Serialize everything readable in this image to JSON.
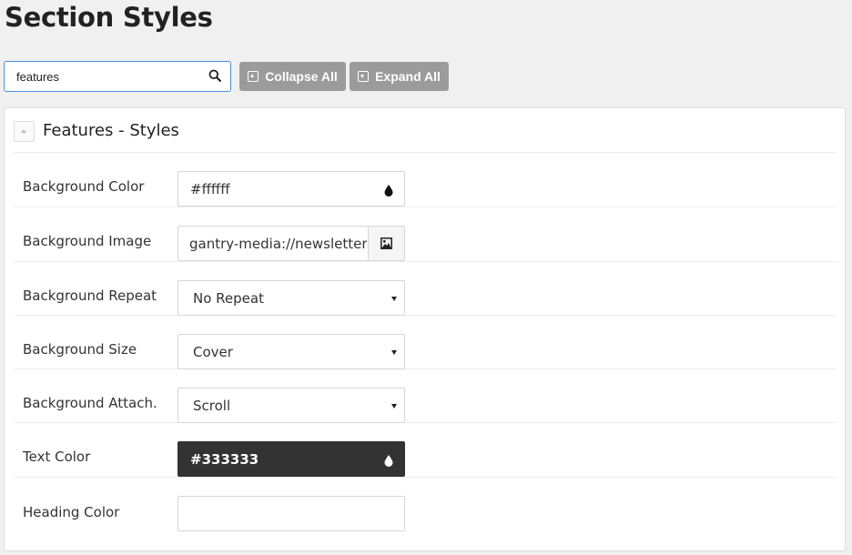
{
  "page": {
    "title": "Section Styles"
  },
  "toolbar": {
    "search_value": "features",
    "collapse_label": "Collapse All",
    "expand_label": "Expand All"
  },
  "panel": {
    "title": "Features - Styles",
    "fields": [
      {
        "label": "Background Color",
        "value": "#ffffff",
        "kind": "color"
      },
      {
        "label": "Background Image",
        "value": "gantry-media://newsletter.",
        "kind": "image"
      },
      {
        "label": "Background Repeat",
        "value": "No Repeat",
        "kind": "select"
      },
      {
        "label": "Background Size",
        "value": "Cover",
        "kind": "select"
      },
      {
        "label": "Background Attach.",
        "value": "Scroll",
        "kind": "select"
      },
      {
        "label": "Text Color",
        "value": "#333333",
        "kind": "color"
      },
      {
        "label": "Heading Color",
        "value": "",
        "kind": "color"
      }
    ]
  },
  "colors": {
    "accent_border": "#4a90d9",
    "button_gray": "#9b9b9b",
    "text_color_swatch": "#333333"
  },
  "icons": {
    "search": "search-icon",
    "collapse": "collapse-all-icon",
    "expand": "expand-all-icon",
    "color_picker": "droplet-icon",
    "media_picker": "image-icon"
  }
}
